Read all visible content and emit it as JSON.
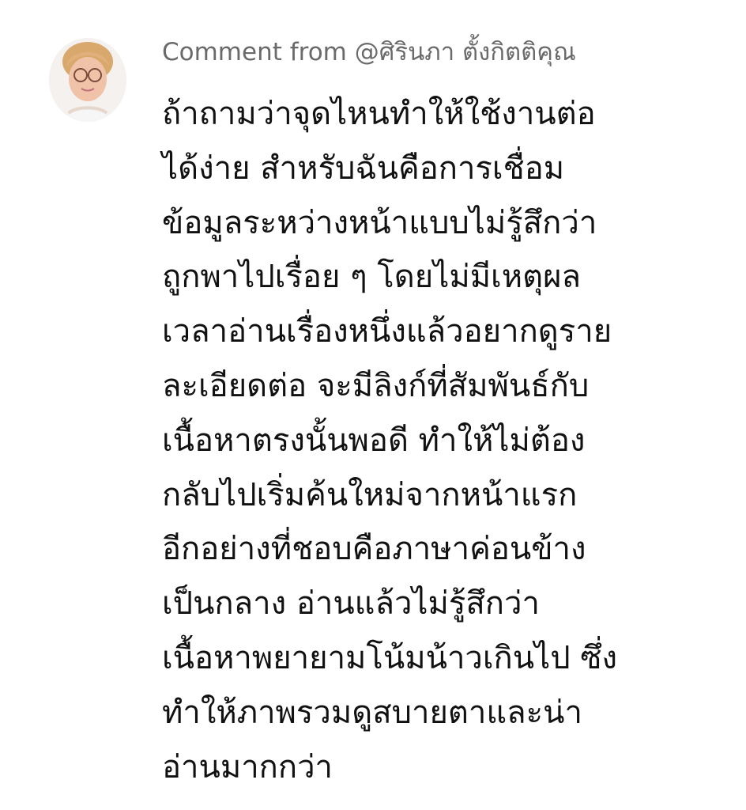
{
  "comment": {
    "header_prefix": "Comment from ",
    "author_handle": "@ศิรินภา ตั้งกิตติคุณ",
    "body_lines": [
      "ถ้าถามว่าจุดไหนทำให้ใช้งานต่อ",
      "ได้ง่าย สำหรับฉันคือการเชื่อม",
      "ข้อมูลระหว่างหน้าแบบไม่รู้สึกว่า",
      "ถูกพาไปเรื่อย ๆ โดยไม่มีเหตุผล",
      "เวลาอ่านเรื่องหนึ่งแล้วอยากดูราย",
      "ละเอียดต่อ จะมีลิงก์ที่สัมพันธ์กับ",
      "เนื้อหาตรงนั้นพอดี ทำให้ไม่ต้อง",
      "กลับไปเริ่มค้นใหม่จากหน้าแรก",
      "อีกอย่างที่ชอบคือภาษาค่อนข้าง",
      "เป็นกลาง อ่านแล้วไม่รู้สึกว่า",
      "เนื้อหาพยายามโน้มน้าวเกินไป ซึ่ง",
      "ทำให้ภาพรวมดูสบายตาและน่า",
      "อ่านมากกว่า"
    ]
  },
  "colors": {
    "background": "#ffffff",
    "header_text": "#6a6a6a",
    "body_text": "#111111"
  }
}
